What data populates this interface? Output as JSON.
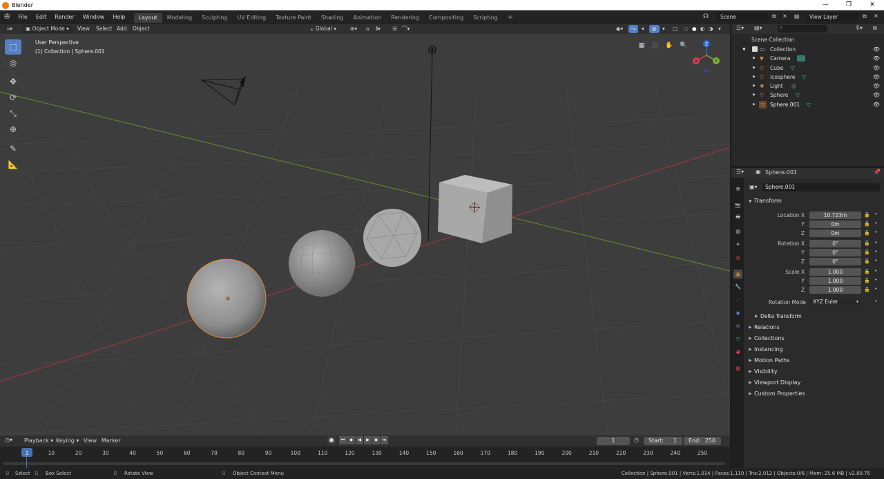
{
  "window": {
    "title": "Blender"
  },
  "menu": [
    "File",
    "Edit",
    "Render",
    "Window",
    "Help"
  ],
  "workspaces": [
    "Layout",
    "Modeling",
    "Sculpting",
    "UV Editing",
    "Texture Paint",
    "Shading",
    "Animation",
    "Rendering",
    "Compositing",
    "Scripting"
  ],
  "active_workspace": "Layout",
  "add_workspace": "+",
  "scene": "Scene",
  "view_layer": "View Layer",
  "viewport_header": {
    "mode": "Object Mode",
    "view": "View",
    "select": "Select",
    "add": "Add",
    "object": "Object",
    "orientation": "Global"
  },
  "viewport": {
    "perspective": "User Perspective",
    "context": "(1) Collection | Sphere.001",
    "gizmo": {
      "x": "X",
      "y": "Y",
      "z": "Z"
    }
  },
  "outliner": {
    "root": "Scene Collection",
    "collection": "Collection",
    "items": [
      {
        "name": "Camera",
        "icon": "camera-icon"
      },
      {
        "name": "Cube",
        "icon": "mesh-icon"
      },
      {
        "name": "Icosphere",
        "icon": "mesh-icon"
      },
      {
        "name": "Light",
        "icon": "light-icon"
      },
      {
        "name": "Sphere",
        "icon": "mesh-icon"
      },
      {
        "name": "Sphere.001",
        "icon": "mesh-icon"
      }
    ]
  },
  "properties": {
    "context_name": "Sphere.001",
    "object_name": "Sphere.001",
    "transform": {
      "title": "Transform",
      "location_label": "Location X",
      "location": [
        "10.723m",
        "0m",
        "0m"
      ],
      "rotation_label": "Rotation X",
      "rotation": [
        "0°",
        "0°",
        "0°"
      ],
      "scale_label": "Scale X",
      "scale": [
        "1.000",
        "1.000",
        "1.000"
      ],
      "axis_y": "Y",
      "axis_z": "Z",
      "rotation_mode_label": "Rotation Mode",
      "rotation_mode": "XYZ Euler",
      "delta": "Delta Transform"
    },
    "panels": [
      "Relations",
      "Collections",
      "Instancing",
      "Motion Paths",
      "Visibility",
      "Viewport Display",
      "Custom Properties"
    ]
  },
  "timeline": {
    "menus": [
      "Playback",
      "Keying",
      "View",
      "Marker"
    ],
    "current_frame": "1",
    "start_label": "Start:",
    "start": "1",
    "end_label": "End:",
    "end": "250",
    "ruler": [
      "1",
      "10",
      "20",
      "30",
      "40",
      "50",
      "60",
      "70",
      "80",
      "90",
      "100",
      "110",
      "120",
      "130",
      "140",
      "150",
      "160",
      "170",
      "180",
      "190",
      "200",
      "210",
      "220",
      "230",
      "240",
      "250"
    ]
  },
  "status": {
    "select": "Select",
    "box_select": "Box Select",
    "rotate_view": "Rotate View",
    "context_menu": "Object Context Menu",
    "stats": "Collection | Sphere.001 | Verts:1,014 | Faces:1,110 | Tris:2,012 | Objects:0/6 | Mem: 25.6 MB | v2.80.75"
  },
  "colors": {
    "accent": "#5680c2",
    "mesh": "#4fc8b0",
    "object_orange": "#e8862a",
    "x_axis": "#d64050",
    "y_axis": "#80b030"
  }
}
